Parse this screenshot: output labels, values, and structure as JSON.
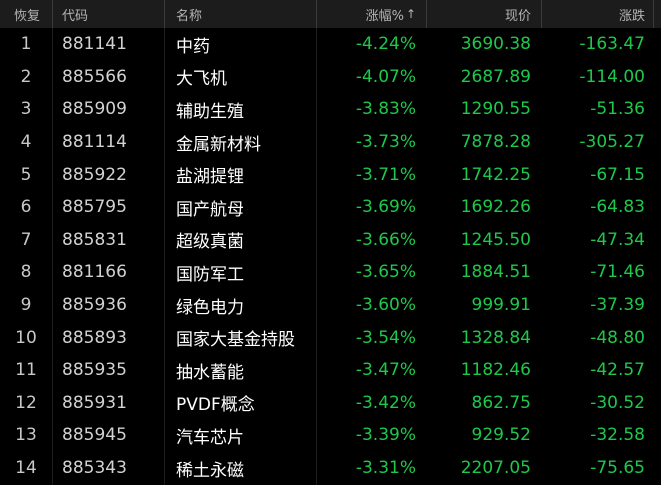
{
  "colors": {
    "background": "#000000",
    "header_bg": "#1c1c1c",
    "header_text": "#b4b4b4",
    "down_green": "#1ec84b",
    "name_text": "#ffffff"
  },
  "header": {
    "restore": "恢复",
    "code": "代码",
    "name": "名称",
    "pct": "涨幅%",
    "sort_arrow": "↑",
    "price": "现价",
    "change": "涨跌"
  },
  "rows": [
    {
      "idx": "1",
      "code": "881141",
      "name": "中药",
      "pct": "-4.24%",
      "price": "3690.38",
      "change": "-163.47"
    },
    {
      "idx": "2",
      "code": "885566",
      "name": "大飞机",
      "pct": "-4.07%",
      "price": "2687.89",
      "change": "-114.00"
    },
    {
      "idx": "3",
      "code": "885909",
      "name": "辅助生殖",
      "pct": "-3.83%",
      "price": "1290.55",
      "change": "-51.36"
    },
    {
      "idx": "4",
      "code": "881114",
      "name": "金属新材料",
      "pct": "-3.73%",
      "price": "7878.28",
      "change": "-305.27"
    },
    {
      "idx": "5",
      "code": "885922",
      "name": "盐湖提锂",
      "pct": "-3.71%",
      "price": "1742.25",
      "change": "-67.15"
    },
    {
      "idx": "6",
      "code": "885795",
      "name": "国产航母",
      "pct": "-3.69%",
      "price": "1692.26",
      "change": "-64.83"
    },
    {
      "idx": "7",
      "code": "885831",
      "name": "超级真菌",
      "pct": "-3.66%",
      "price": "1245.50",
      "change": "-47.34"
    },
    {
      "idx": "8",
      "code": "881166",
      "name": "国防军工",
      "pct": "-3.65%",
      "price": "1884.51",
      "change": "-71.46"
    },
    {
      "idx": "9",
      "code": "885936",
      "name": "绿色电力",
      "pct": "-3.60%",
      "price": "999.91",
      "change": "-37.39"
    },
    {
      "idx": "10",
      "code": "885893",
      "name": "国家大基金持股",
      "pct": "-3.54%",
      "price": "1328.84",
      "change": "-48.80"
    },
    {
      "idx": "11",
      "code": "885935",
      "name": "抽水蓄能",
      "pct": "-3.47%",
      "price": "1182.46",
      "change": "-42.57"
    },
    {
      "idx": "12",
      "code": "885931",
      "name": "PVDF概念",
      "pct": "-3.42%",
      "price": "862.75",
      "change": "-30.52"
    },
    {
      "idx": "13",
      "code": "885945",
      "name": "汽车芯片",
      "pct": "-3.39%",
      "price": "929.52",
      "change": "-32.58"
    },
    {
      "idx": "14",
      "code": "885343",
      "name": "稀土永磁",
      "pct": "-3.31%",
      "price": "2207.05",
      "change": "-75.65"
    }
  ]
}
